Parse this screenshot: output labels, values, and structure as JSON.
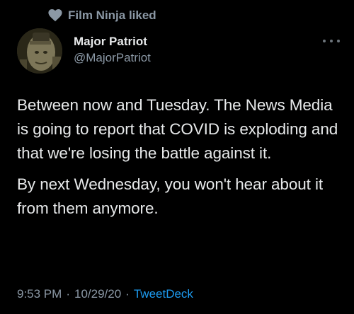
{
  "social_context": {
    "icon": "heart-icon",
    "text": "Film Ninja liked"
  },
  "author": {
    "display_name": "Major Patriot",
    "handle": "@MajorPatriot"
  },
  "more_menu": {
    "icon": "more-horizontal-icon"
  },
  "tweet": {
    "paragraphs": [
      "Between now and Tuesday.  The News Media is going to report that COVID is exploding and that we're losing the battle against it.",
      "By next Wednesday, you won't hear about it from them anymore."
    ]
  },
  "meta": {
    "time": "9:53 PM",
    "sep1": "·",
    "date": "10/29/20",
    "sep2": "·",
    "source": "TweetDeck"
  },
  "colors": {
    "background": "#000000",
    "text": "#e7e9ea",
    "secondary": "#8b98a5",
    "link": "#1d9bf0"
  }
}
